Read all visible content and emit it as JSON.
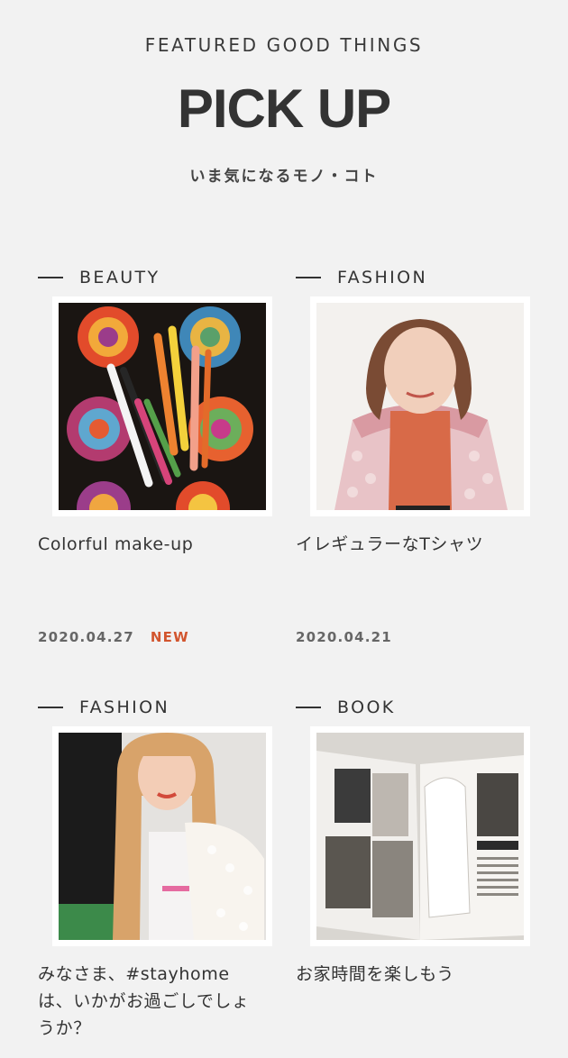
{
  "header": {
    "eyebrow": "FEATURED GOOD THINGS",
    "title": "PICK UP",
    "subtitle": "いま気になるモノ・コト"
  },
  "articles": [
    {
      "category": "BEAUTY",
      "title": "Colorful make-up",
      "date": "2020.04.27",
      "badge": "NEW",
      "badge_color": "#d2552e",
      "image": "colorful eyeliner pens on crochet granny squares"
    },
    {
      "category": "FASHION",
      "title": "イレギュラーなTシャツ",
      "date": "2020.04.21",
      "image": "woman in orange t-shirt and lace cardigan"
    },
    {
      "category": "FASHION",
      "title": "みなさま、#stayhome は、いかがお過ごしでしょうか？",
      "image": "woman with long blonde hair and white knit cardigan"
    },
    {
      "category": "BOOK",
      "title": "お家時間を楽しもう",
      "image": "open fashion magazine spread"
    }
  ]
}
